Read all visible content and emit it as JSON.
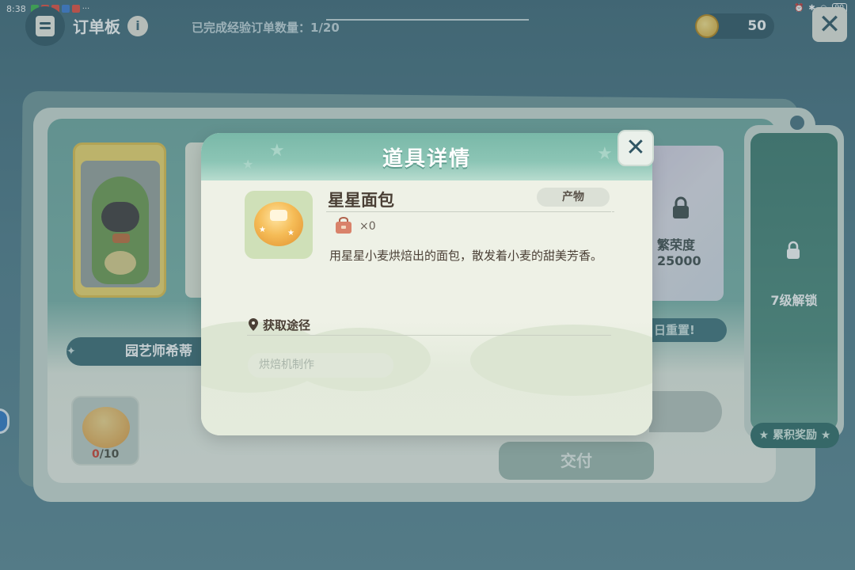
{
  "status_bar": {
    "time": "8:38",
    "battery": "90"
  },
  "top_bar": {
    "title": "订单板",
    "info_icon": "i",
    "progress_label": "已完成经验订单数量：",
    "progress_value": "1/20",
    "coins": "50",
    "close_glyph": "✕"
  },
  "board": {
    "gardener_name": "园艺师希蒂",
    "locked_card": {
      "label": "繁荣度",
      "value": "25000"
    },
    "reset_text": "日重置!",
    "order": {
      "current": "0",
      "total": "/10"
    },
    "deliver_button": "交付",
    "side_panel": {
      "unlock_text": "7级解锁",
      "reward_button": "累积奖励"
    }
  },
  "modal": {
    "title": "道具详情",
    "item": {
      "name": "星星面包",
      "tag": "产物",
      "owned": "×0",
      "description": "用星星小麦烘焙出的面包，散发着小麦的甜美芳香。"
    },
    "source": {
      "heading": "获取途径",
      "method": "烘焙机制作"
    },
    "close_glyph": "✕"
  },
  "colors": {
    "background": "#48707f",
    "modal_header": "#79b8a8",
    "accent_text": "#4a3f35"
  },
  "icons": [
    "order-board-icon",
    "info-icon",
    "coin-icon",
    "close-icon",
    "lock-icon",
    "bag-icon",
    "location-pin-icon",
    "star-bread-icon"
  ]
}
